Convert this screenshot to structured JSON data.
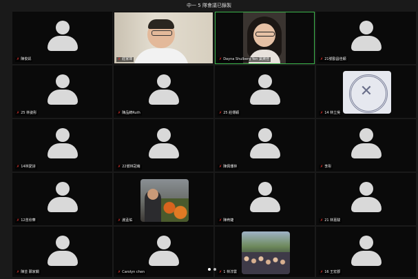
{
  "topbar": {
    "title": "中一 5 隊會議已錄製"
  },
  "tiles": [
    {
      "name": "陳俊凱",
      "type": "avatar"
    },
    {
      "name": "莊家瑋",
      "type": "video-man"
    },
    {
      "name": "Dayna Shulberg Yen 葉黛佳",
      "type": "video-woman",
      "active": true
    },
    {
      "name": "21號歐昌佳穎",
      "type": "avatar"
    },
    {
      "name": "25 林姿彤",
      "type": "avatar"
    },
    {
      "name": "陳品綺Ruth",
      "type": "avatar"
    },
    {
      "name": "25 莊傳穎",
      "type": "avatar"
    },
    {
      "name": "14 林立吳",
      "type": "video-seal"
    },
    {
      "name": "14林愛詩",
      "type": "avatar"
    },
    {
      "name": "22號林冠萌",
      "type": "avatar"
    },
    {
      "name": "陳佩珊林",
      "type": "avatar"
    },
    {
      "name": "李彤",
      "type": "avatar"
    },
    {
      "name": "12曾欣華",
      "type": "avatar"
    },
    {
      "name": "謝孟佑",
      "type": "video-photo"
    },
    {
      "name": "陳宥婕",
      "type": "avatar"
    },
    {
      "name": "21 林嘉駿",
      "type": "avatar"
    },
    {
      "name": "陳芸 鄭家嫻",
      "type": "avatar"
    },
    {
      "name": "Carolyn chen",
      "type": "avatar"
    },
    {
      "name": "1 林淳雲",
      "type": "video-group"
    },
    {
      "name": "16 王宏郡",
      "type": "avatar"
    }
  ],
  "pager": {
    "pages": 2,
    "current": 1
  },
  "colors": {
    "active_border": "#3bb54a",
    "muted_mic": "#e0322c",
    "background": "#1a1a1a"
  },
  "icons": {
    "muted": "microphone-muted-icon"
  }
}
